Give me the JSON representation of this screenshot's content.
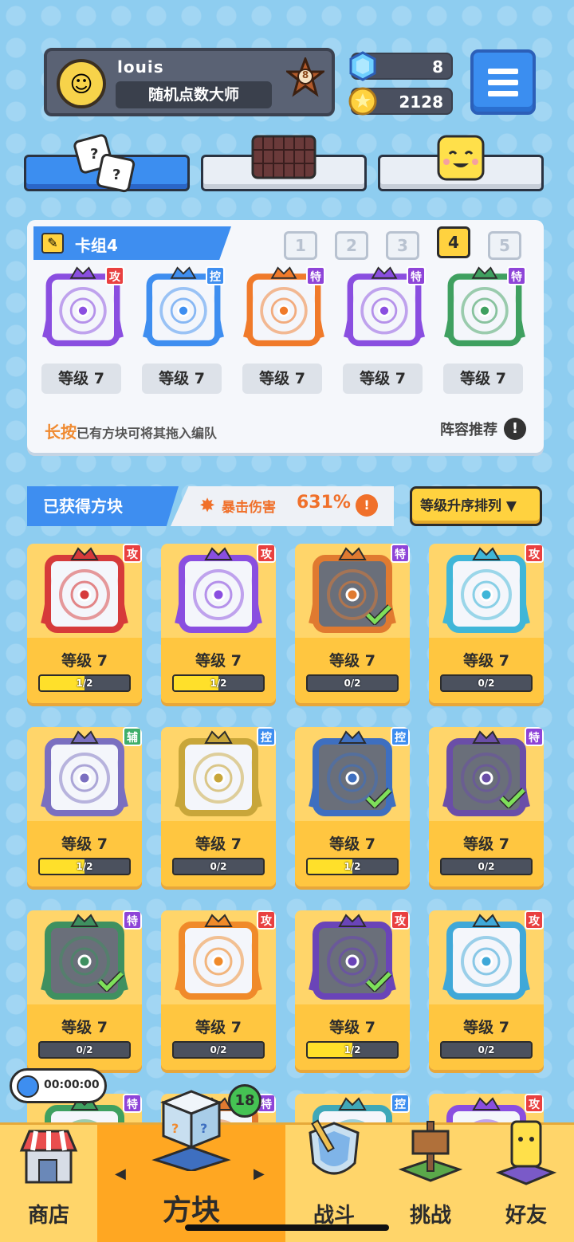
{
  "profile": {
    "name": "louis",
    "title": "随机点数大师",
    "rank": "8"
  },
  "currency": {
    "gems": "8",
    "coins": "2128"
  },
  "top_tabs": [
    "dice-tab",
    "board-tab",
    "emoji-tab"
  ],
  "deck": {
    "title": "卡组4",
    "numbers": [
      "1",
      "2",
      "3",
      "4",
      "5"
    ],
    "selected": "4",
    "cards": [
      {
        "type": "攻",
        "color": "#8a4ee0",
        "badge_color": "#e94040",
        "level": "等级 7"
      },
      {
        "type": "控",
        "color": "#3e8ef0",
        "badge_color": "#3e8ef0",
        "level": "等级 7"
      },
      {
        "type": "特",
        "color": "#f07a2a",
        "badge_color": "#8e44d8",
        "level": "等级 7"
      },
      {
        "type": "特",
        "color": "#8a4ee0",
        "badge_color": "#8e44d8",
        "level": "等级 7"
      },
      {
        "type": "特",
        "color": "#3fa060",
        "badge_color": "#8e44d8",
        "level": "等级 7"
      }
    ],
    "hint_highlight": "长按",
    "hint_text": "已有方块可将其拖入编队",
    "lineup_label": "阵容推荐",
    "lineup_icon": "!"
  },
  "owned": {
    "label": "已获得方块",
    "crit_label": "暴击伤害",
    "crit_value": "631%",
    "crit_icon": "!",
    "sort_label": "等级升序排列",
    "sort_arrow": "▼"
  },
  "grid": [
    {
      "type": "攻",
      "badge_color": "#e94040",
      "color": "#d63a3a",
      "level": "等级 7",
      "progress": "1/2",
      "fill": 0.5,
      "checked": false,
      "dim": false
    },
    {
      "type": "攻",
      "badge_color": "#e94040",
      "color": "#8a4ee0",
      "level": "等级 7",
      "progress": "1/2",
      "fill": 0.5,
      "checked": false,
      "dim": false
    },
    {
      "type": "特",
      "badge_color": "#8e44d8",
      "color": "#e07a30",
      "level": "等级 7",
      "progress": "0/2",
      "fill": 0,
      "checked": true,
      "dim": true
    },
    {
      "type": "攻",
      "badge_color": "#e94040",
      "color": "#3fb6d8",
      "level": "等级 7",
      "progress": "0/2",
      "fill": 0,
      "checked": false,
      "dim": false
    },
    {
      "type": "辅",
      "badge_color": "#3fae6a",
      "color": "#7a6fc0",
      "level": "等级 7",
      "progress": "1/2",
      "fill": 0.5,
      "checked": false,
      "dim": false
    },
    {
      "type": "控",
      "badge_color": "#3e8ef0",
      "color": "#c8a63a",
      "level": "等级 7",
      "progress": "0/2",
      "fill": 0,
      "checked": false,
      "dim": false
    },
    {
      "type": "控",
      "badge_color": "#3e8ef0",
      "color": "#3e6fc0",
      "level": "等级 7",
      "progress": "1/2",
      "fill": 0.5,
      "checked": true,
      "dim": true
    },
    {
      "type": "特",
      "badge_color": "#8e44d8",
      "color": "#6a4ea8",
      "level": "等级 7",
      "progress": "0/2",
      "fill": 0,
      "checked": true,
      "dim": true
    },
    {
      "type": "特",
      "badge_color": "#8e44d8",
      "color": "#3f9060",
      "level": "等级 7",
      "progress": "0/2",
      "fill": 0,
      "checked": true,
      "dim": true
    },
    {
      "type": "攻",
      "badge_color": "#e94040",
      "color": "#f08a2a",
      "level": "等级 7",
      "progress": "0/2",
      "fill": 0,
      "checked": false,
      "dim": false
    },
    {
      "type": "攻",
      "badge_color": "#e94040",
      "color": "#6a44b8",
      "level": "等级 7",
      "progress": "1/2",
      "fill": 0.5,
      "checked": true,
      "dim": true
    },
    {
      "type": "攻",
      "badge_color": "#e94040",
      "color": "#3fa8d8",
      "level": "等级 7",
      "progress": "0/2",
      "fill": 0,
      "checked": false,
      "dim": false
    },
    {
      "type": "特",
      "badge_color": "#8e44d8",
      "color": "#3fa060",
      "level": "",
      "progress": "",
      "fill": 0,
      "checked": false,
      "dim": false
    },
    {
      "type": "特",
      "badge_color": "#8e44d8",
      "color": "#e07a30",
      "level": "",
      "progress": "",
      "fill": 0,
      "checked": false,
      "dim": false
    },
    {
      "type": "控",
      "badge_color": "#3e8ef0",
      "color": "#3fa8b8",
      "level": "",
      "progress": "",
      "fill": 0,
      "checked": false,
      "dim": false
    },
    {
      "type": "攻",
      "badge_color": "#e94040",
      "color": "#8a4ee0",
      "level": "",
      "progress": "",
      "fill": 0,
      "checked": false,
      "dim": false
    }
  ],
  "timer": "00:00:00",
  "nav": {
    "shop": "商店",
    "blocks": "方块",
    "battle": "战斗",
    "challenge": "挑战",
    "friends": "好友",
    "blocks_badge": "18",
    "left_arrow": "◀",
    "right_arrow": "▶"
  }
}
